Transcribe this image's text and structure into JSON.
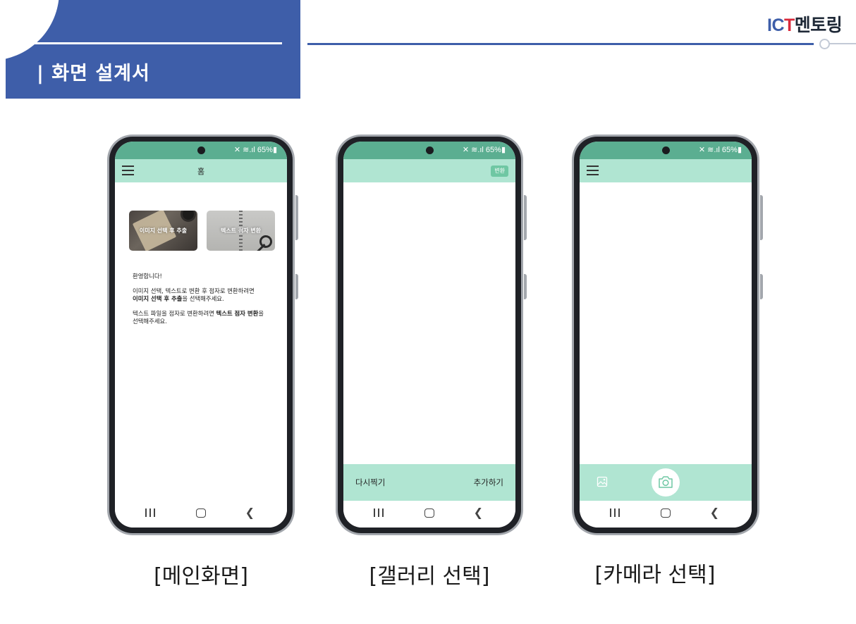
{
  "slide": {
    "section_title": "| 화면 설계서",
    "logo": {
      "part1": "I",
      "part2": "C",
      "part3": "T",
      "part4": "멘토링"
    }
  },
  "status_bar": {
    "icons_text": "✕ ≋.ıl 65%▮"
  },
  "screens": {
    "main": {
      "caption": "[메인화면]",
      "appbar_title": "홈",
      "cards": [
        {
          "label": "이미지 선택 후 추출"
        },
        {
          "label": "텍스트 점자 변환"
        }
      ],
      "intro": {
        "welcome": "환영합니다!",
        "line1": "이미지 선택, 텍스트로 변환 후 점자로 변환하려면",
        "line2_bold": "이미지 선택 후 추출",
        "line2_rest": "을 선택해주세요.",
        "line3_pre": "텍스트 파일을 점자로 변환하려면 ",
        "line3_bold": "텍스트 점자 변환",
        "line3_post": "을",
        "line4": "선택해주세요."
      }
    },
    "gallery": {
      "caption": "[갤러리 선택]",
      "convert_button": "변환",
      "retake_label": "다시찍기",
      "add_label": "추가하기"
    },
    "camera": {
      "caption": "[카메라 선택]"
    }
  },
  "colors": {
    "header_blue": "#3e5ea9",
    "status_green": "#5bae91",
    "appbar_mint": "#b0e5d2",
    "button_green": "#6fc7a3"
  }
}
